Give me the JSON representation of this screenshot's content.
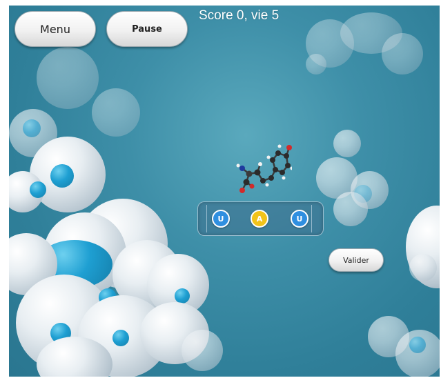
{
  "toolbar": {
    "menu_label": "Menu",
    "pause_label": "Pause"
  },
  "status": {
    "score_text": "Score 0, vie 5"
  },
  "codon": {
    "nucleotides": [
      {
        "letter": "U",
        "color": "#2f8fe0"
      },
      {
        "letter": "A",
        "color": "#f2c31a"
      },
      {
        "letter": "U",
        "color": "#2f8fe0"
      }
    ]
  },
  "actions": {
    "validate_label": "Valider"
  },
  "icons": {
    "molecule": "amino-acid-molecule-icon"
  },
  "colors": {
    "background": "#3a8aa3",
    "nucleotide_u": "#2f8fe0",
    "nucleotide_a": "#f2c31a"
  }
}
